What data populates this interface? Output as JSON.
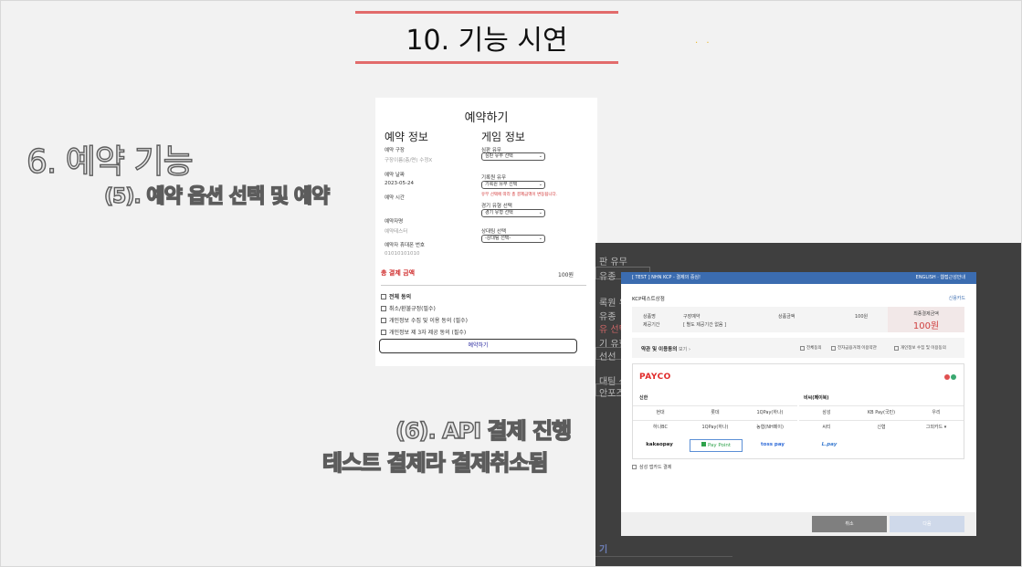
{
  "slide": {
    "title": "10. 기능 시연",
    "caption_reserve": "6. 예약 기능",
    "caption_option": "(5). 예약 옵션 선택 및 예약",
    "caption_api": "(6). API 결제 진행",
    "caption_test": "테스트 결제라 결제취소됨",
    "deco_dots": ". ."
  },
  "form": {
    "title": "예약하기",
    "section_reservation": "예약 정보",
    "section_game": "게임 정보",
    "venue_label": "예약 구장",
    "venue_value": "구장이름(층/면) 수정X",
    "date_label": "예약 날짜",
    "date_value": "2023-05-24",
    "time_label": "예약 시간",
    "name_label": "예약자명",
    "name_value": "예약테스터",
    "phone_label": "예약자 휴대폰 번호",
    "phone_value": "01010101010",
    "judge_label": "심판 유무",
    "judge_select": "심판 유무 선택",
    "recorder_label": "기록원 유무",
    "recorder_select": "기록원 유무 선택",
    "recorder_warning": "유무 선택에 따라 총 결제금액이 변동됩니다.",
    "match_label": "경기 유형 선택",
    "match_select": "경기 유형 선택",
    "opponent_label": "상대팀 선택",
    "opponent_select": "-상대팀 선택-",
    "total_label": "총 결제 금액",
    "total_value": "100원",
    "agree_all": "전체 동의",
    "agree_refund": "취소/환불규정(필수)",
    "agree_privacy": "개인정보 수집 및 이용 동의 (필수)",
    "agree_third": "개인정보 제 3자 제공 동의 (필수)",
    "reserve_button": "예약하기"
  },
  "background": {
    "t1": "판 유무",
    "t2": "유종",
    "t3": "록원 유",
    "t4": "유종",
    "t5": "유 선택",
    "t6": "기 유형",
    "t7": "선선",
    "t8": "대팀 선",
    "t9": "안포즈",
    "t10": "기"
  },
  "modal": {
    "header_left": "[ TEST ] NHN KCP - 결제의 중심!",
    "header_right": "ENGLISH · 웹접근성안내",
    "merchant": "KCP테스트상점",
    "card_link": "신용카드",
    "product_label": "상품명",
    "product_value": "구장예약",
    "period_label": "제공기간",
    "period_value": "[ 별도 제공기간 없음 ]",
    "amount_label": "상품금액",
    "amount_value": "100원",
    "final_label": "최종결제금액",
    "final_value": "100원",
    "terms_title": "약관 및 이용동의",
    "terms_more": "보기",
    "terms_all": "전체동의",
    "terms_ecommerce": "전자금융거래 이용약관",
    "terms_privacy": "개인정보 수집 및 이용동의",
    "payco": "PAYCO",
    "group_shinhan": "신한",
    "group_bc": "비씨(페이북)",
    "cards": [
      "현대",
      "롯데",
      "1QPay(하나)",
      "삼성",
      "KB Pay(국민)",
      "우리",
      "하나BC",
      "1QPay(하나)",
      "농협(NH페이)",
      "씨티",
      "신협",
      "그외카드"
    ],
    "easy_pay": [
      "kakaopay",
      "Pay Point",
      "toss pay",
      "L.pay"
    ],
    "samsung": "삼성 앱카드 결제",
    "cancel_button": "취소",
    "next_button": "다음"
  },
  "colors": {
    "title_line": "#e26b6b",
    "kcp_header": "#3b6cb0",
    "payco_red": "#e02a2a",
    "final_red": "#d04040"
  }
}
